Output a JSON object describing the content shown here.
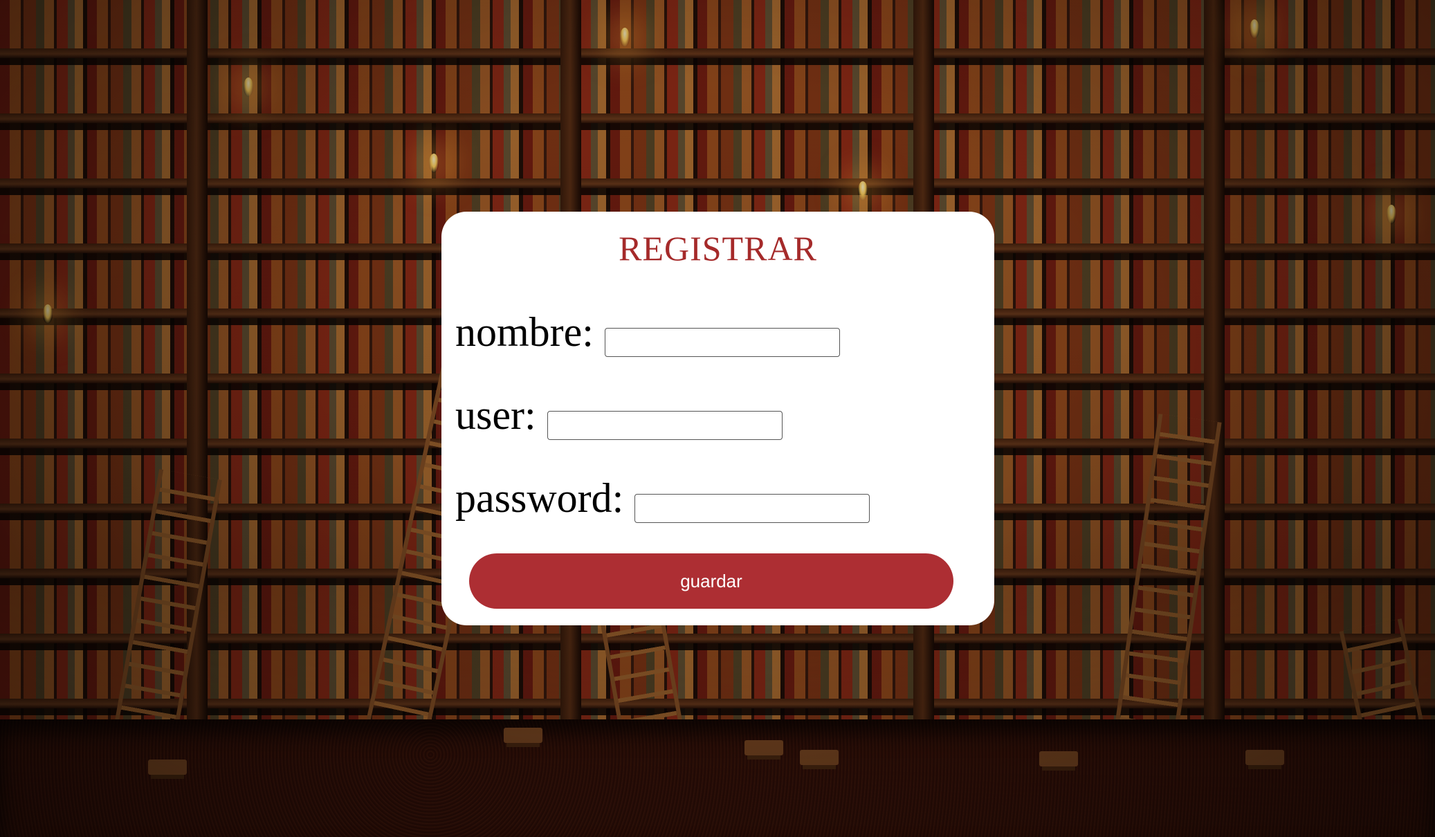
{
  "form": {
    "title": "REGISTRAR",
    "fields": [
      {
        "label": "nombre:",
        "value": "",
        "placeholder": ""
      },
      {
        "label": "user:",
        "value": "",
        "placeholder": ""
      },
      {
        "label": "password:",
        "value": "",
        "placeholder": ""
      }
    ],
    "submit_label": "guardar"
  },
  "colors": {
    "accent": "#ad2e33",
    "title": "#a52a2a",
    "card_background": "#ffffff"
  }
}
